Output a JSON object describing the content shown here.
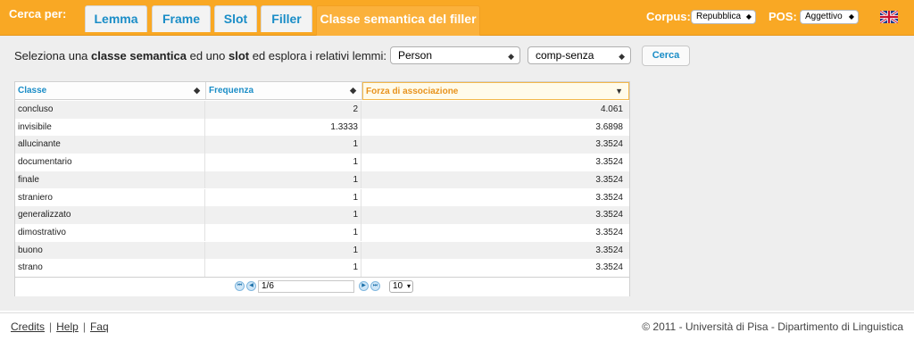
{
  "header": {
    "search_label": "Cerca per:",
    "tabs": [
      {
        "label": "Lemma",
        "active": false
      },
      {
        "label": "Frame",
        "active": false
      },
      {
        "label": "Slot",
        "active": false
      },
      {
        "label": "Filler",
        "active": false
      },
      {
        "label": "Classe semantica del filler",
        "active": true
      }
    ],
    "corpus_label": "Corpus:",
    "corpus_value": "Repubblica",
    "pos_label": "POS:",
    "pos_value": "Aggettivo",
    "language_icon": "uk-flag-icon"
  },
  "search": {
    "intro_pre": "Seleziona una ",
    "intro_bold1": "classe semantica",
    "intro_mid": " ed uno ",
    "intro_bold2": "slot",
    "intro_post": " ed esplora i relativi lemmi:",
    "class_value": "Person",
    "slot_value": "comp-senza",
    "button_label": "Cerca"
  },
  "table": {
    "columns": [
      "Classe",
      "Frequenza",
      "Forza di associazione"
    ],
    "sorted_column": "Forza di associazione",
    "rows": [
      {
        "classe": "concluso",
        "frequenza": "2",
        "forza": "4.061"
      },
      {
        "classe": "invisibile",
        "frequenza": "1.3333",
        "forza": "3.6898"
      },
      {
        "classe": "allucinante",
        "frequenza": "1",
        "forza": "3.3524"
      },
      {
        "classe": "documentario",
        "frequenza": "1",
        "forza": "3.3524"
      },
      {
        "classe": "finale",
        "frequenza": "1",
        "forza": "3.3524"
      },
      {
        "classe": "straniero",
        "frequenza": "1",
        "forza": "3.3524"
      },
      {
        "classe": "generalizzato",
        "frequenza": "1",
        "forza": "3.3524"
      },
      {
        "classe": "dimostrativo",
        "frequenza": "1",
        "forza": "3.3524"
      },
      {
        "classe": "buono",
        "frequenza": "1",
        "forza": "3.3524"
      },
      {
        "classe": "strano",
        "frequenza": "1",
        "forza": "3.3524"
      }
    ],
    "pager": {
      "page": "1/6",
      "per_page": "10"
    }
  },
  "footer": {
    "links": [
      "Credits",
      "Help",
      "Faq"
    ],
    "copyright": "© 2011 - Università di Pisa - Dipartimento di Linguistica"
  },
  "colors": {
    "accent": "#f9a824",
    "link": "#1a8dc7"
  }
}
